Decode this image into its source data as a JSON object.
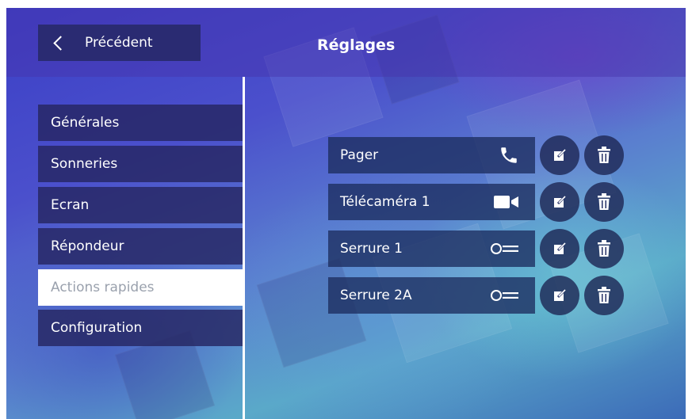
{
  "header": {
    "back_label": "Précédent",
    "title": "Réglages"
  },
  "sidebar": {
    "items": [
      {
        "label": "Générales",
        "active": false
      },
      {
        "label": "Sonneries",
        "active": false
      },
      {
        "label": "Ecran",
        "active": false
      },
      {
        "label": "Répondeur",
        "active": false
      },
      {
        "label": "Actions rapides",
        "active": true
      },
      {
        "label": "Configuration",
        "active": false
      }
    ]
  },
  "actions": [
    {
      "label": "Pager",
      "icon": "phone-icon"
    },
    {
      "label": "Télécaméra 1",
      "icon": "video-camera-icon"
    },
    {
      "label": "Serrure 1",
      "icon": "key-icon"
    },
    {
      "label": "Serrure 2A",
      "icon": "key-icon"
    }
  ],
  "colors": {
    "button_dark": "#2a2b72",
    "active_text": "#9aa1ad"
  }
}
